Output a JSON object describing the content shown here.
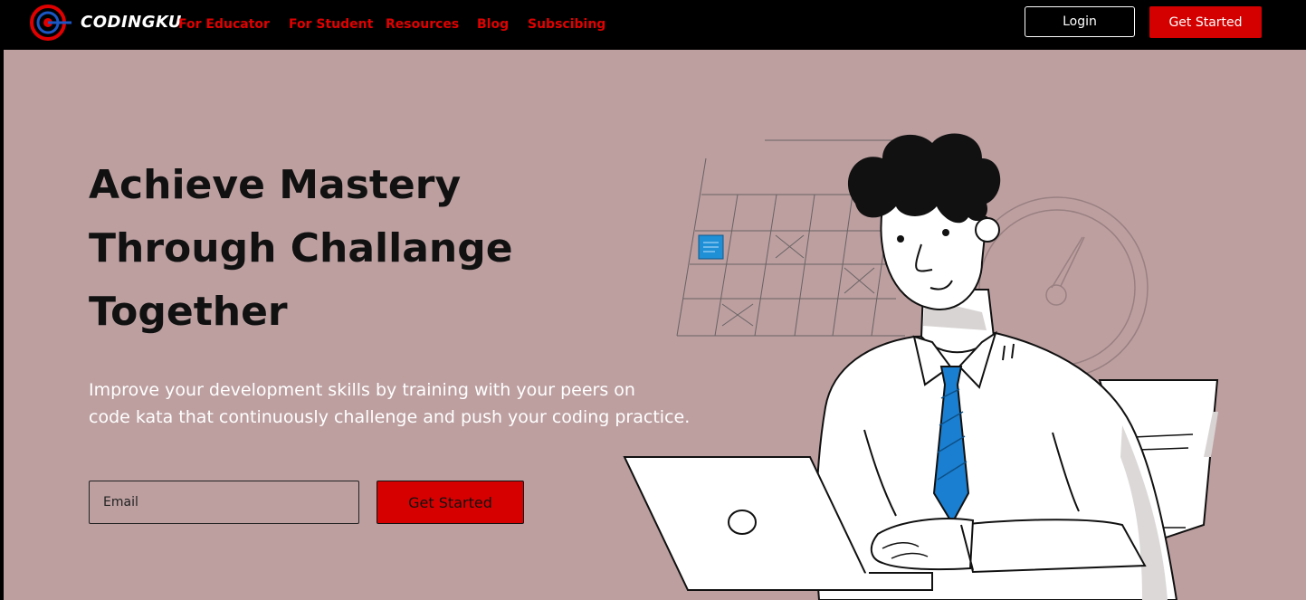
{
  "brand": {
    "name": "CODINGKU"
  },
  "nav": {
    "items": [
      {
        "label": "For Educator"
      },
      {
        "label": "For Student"
      },
      {
        "label": "Resources"
      },
      {
        "label": "Blog"
      },
      {
        "label": "Subscibing"
      }
    ]
  },
  "header": {
    "login_label": "Login",
    "get_started_label": "Get Started"
  },
  "hero": {
    "headline_lines": [
      "Achieve Mastery",
      "Through Challange",
      "Together"
    ],
    "subtitle_lines": [
      "Improve your development skills by training with your peers on",
      "code kata that continuously challenge and push your coding practice."
    ],
    "email_placeholder": "Email",
    "cta_label": "Get Started"
  },
  "colors": {
    "accent": "#d40000",
    "hero_background": "#bd9fa0",
    "topbar": "#000000",
    "tie": "#1a7fd0"
  }
}
